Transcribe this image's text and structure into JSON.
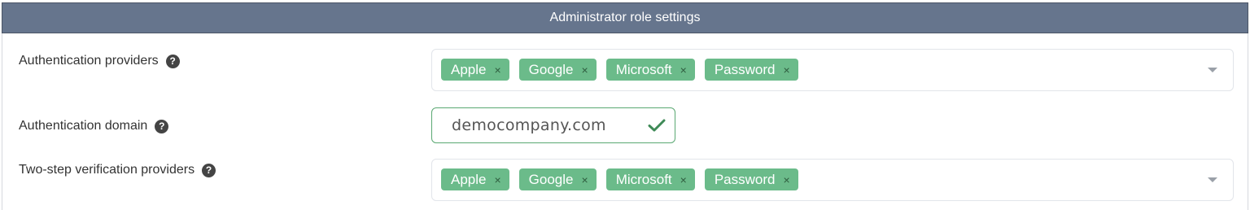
{
  "header": {
    "title": "Administrator role settings"
  },
  "fields": {
    "auth_providers": {
      "label": "Authentication providers",
      "help_icon": "question-circle-icon",
      "tags": [
        "Apple",
        "Google",
        "Microsoft",
        "Password"
      ],
      "remove_glyph": "×"
    },
    "auth_domain": {
      "label": "Authentication domain",
      "help_icon": "question-circle-icon",
      "value": "democompany.com",
      "status_icon": "checkmark-icon"
    },
    "two_step_providers": {
      "label": "Two-step verification providers",
      "help_icon": "question-circle-icon",
      "tags": [
        "Apple",
        "Google",
        "Microsoft",
        "Password"
      ],
      "remove_glyph": "×"
    }
  },
  "help_glyph": "?",
  "colors": {
    "header_bg": "#66758d",
    "tag_bg": "#6bbb8a",
    "valid_border": "#5aa872",
    "check": "#3f8a57"
  }
}
